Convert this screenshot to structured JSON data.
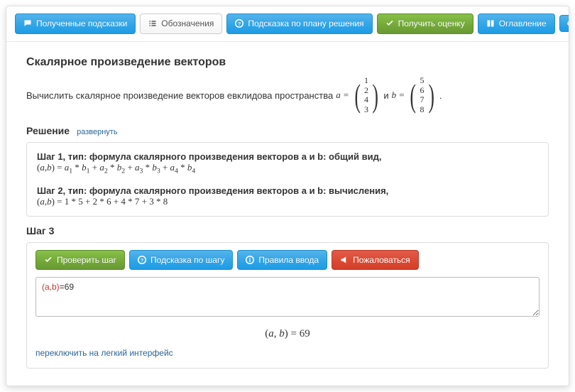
{
  "toolbar": {
    "received_hints": "Полученные подсказки",
    "notation": "Обозначения",
    "plan_hint": "Подсказка по плану решения",
    "get_grade": "Получить оценку",
    "toc": "Оглавление"
  },
  "title": "Скалярное произведение векторов",
  "problem": {
    "prefix": "Вычислить скалярное произведение векторов евклидова пространства ",
    "a_sym": "a =",
    "and": " и ",
    "b_sym": "b =",
    "period": ".",
    "vec_a": [
      "1",
      "2",
      "4",
      "3"
    ],
    "vec_b": [
      "5",
      "6",
      "7",
      "8"
    ]
  },
  "solution": {
    "heading": "Решение",
    "expand": "развернуть",
    "step1_title": "Шаг 1, тип: формула скалярного произведения векторов a и b: общий вид,",
    "step1_formula_html": "(<i>a</i>,<i>b</i>) = <i>a</i><span class='sub'>1</span> * <i>b</i><span class='sub'>1</span> + <i>a</i><span class='sub'>2</span> * <i>b</i><span class='sub'>2</span> + <i>a</i><span class='sub'>3</span> * <i>b</i><span class='sub'>3</span> + <i>a</i><span class='sub'>4</span> * <i>b</i><span class='sub'>4</span>",
    "step2_title": "Шаг 2, тип: формула скалярного произведения векторов a и b: вычисления,",
    "step2_formula_html": "(<i>a</i>,<i>b</i>) = 1 * 5 + 2 * 6 + 4 * 7 + 3 * 8"
  },
  "step3": {
    "heading": "Шаг 3",
    "check": "Проверить шаг",
    "hint": "Подсказка по шагу",
    "rules": "Правила ввода",
    "complain": "Пожаловаться",
    "input_html": "<span class='ab'>(a,b)</span>=69",
    "rendered_html": "(<i>a</i>, <i>b</i>) = 69",
    "switch": "переключить на легкий интерфейс"
  }
}
